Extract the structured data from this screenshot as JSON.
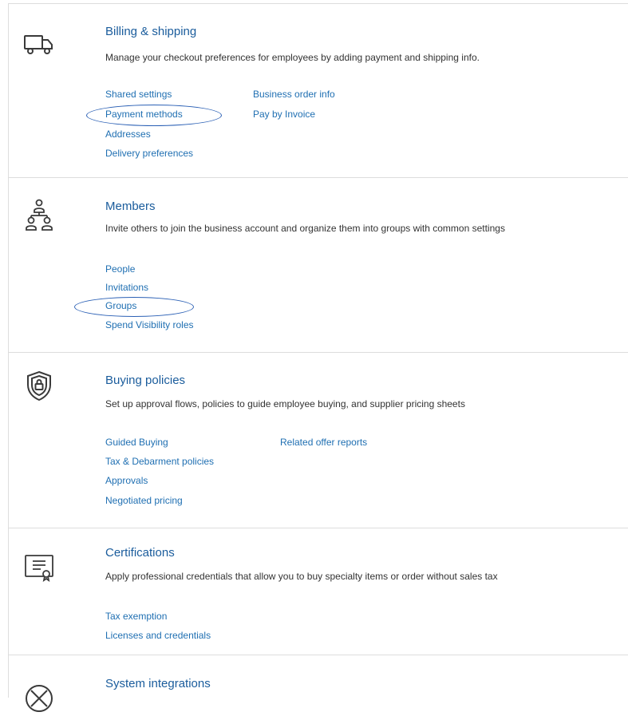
{
  "sections": [
    {
      "id": "billing",
      "icon": "truck-icon",
      "title": "Billing & shipping",
      "description": "Manage your checkout preferences for employees by adding payment and shipping info.",
      "links_col1": [
        "Shared settings",
        "Payment methods",
        "Addresses",
        "Delivery preferences"
      ],
      "links_col2": [
        "Business order info",
        "Pay by Invoice"
      ]
    },
    {
      "id": "members",
      "icon": "org-people-icon",
      "title": "Members",
      "description": "Invite others to join the business account and organize them into groups with common settings",
      "links_col1": [
        "People",
        "Invitations",
        "Groups",
        "Spend Visibility roles"
      ],
      "links_col2": []
    },
    {
      "id": "buying",
      "icon": "shield-lock-icon",
      "title": "Buying policies",
      "description": "Set up approval flows, policies to guide employee buying, and supplier pricing sheets",
      "links_col1": [
        "Guided Buying",
        "Tax & Debarment policies",
        "Approvals",
        "Negotiated pricing"
      ],
      "links_col2": [
        "Related offer reports"
      ]
    },
    {
      "id": "certs",
      "icon": "certificate-icon",
      "title": "Certifications",
      "description": "Apply professional credentials that allow you to buy specialty items or order without sales tax",
      "links_col1": [
        "Tax exemption",
        "Licenses and credentials"
      ],
      "links_col2": []
    },
    {
      "id": "integrations",
      "icon": "integration-icon",
      "title": "System integrations",
      "description": "",
      "links_col1": [],
      "links_col2": []
    }
  ],
  "colors": {
    "link": "#1f6fb2",
    "title": "#1a5c9c",
    "highlight": "#2b60b5",
    "border": "#dddddd"
  }
}
